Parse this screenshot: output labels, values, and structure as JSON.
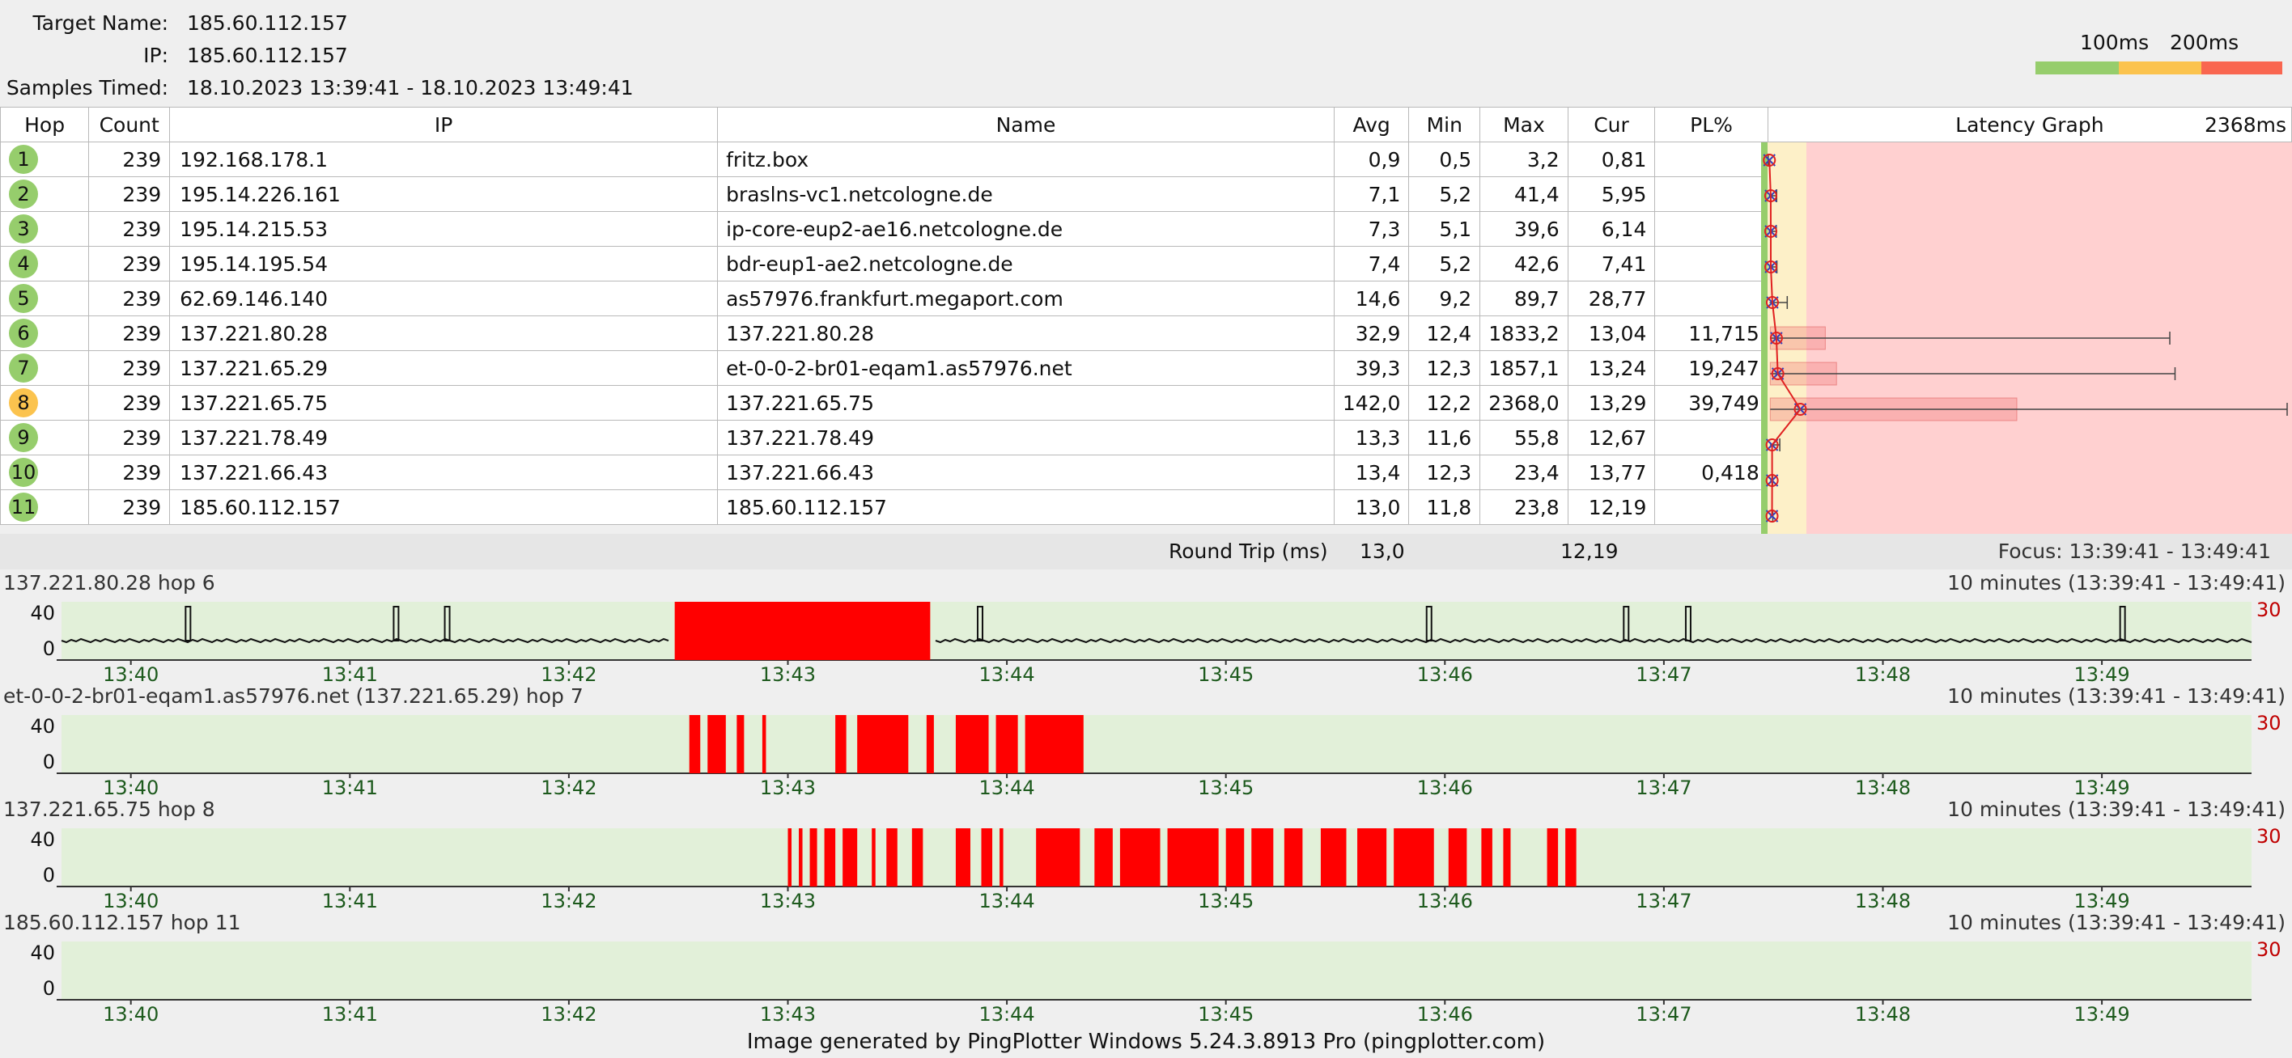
{
  "header": {
    "target_name_label": "Target Name:",
    "target_name": "185.60.112.157",
    "ip_label": "IP:",
    "ip": "185.60.112.157",
    "samples_label": "Samples Timed:",
    "samples": "18.10.2023 13:39:41 - 18.10.2023 13:49:41"
  },
  "legend": {
    "label_100": "100ms",
    "label_200": "200ms",
    "colors": [
      "#96cd6c",
      "#fbc34e",
      "#f96650"
    ]
  },
  "table": {
    "columns": [
      "Hop",
      "Count",
      "IP",
      "Name",
      "Avg",
      "Min",
      "Max",
      "Cur",
      "PL%",
      "Latency Graph"
    ],
    "graph_max": "2368ms",
    "rows": [
      {
        "hop": "1",
        "count": "239",
        "ip": "192.168.178.1",
        "name": "fritz.box",
        "avg": "0,9",
        "min": "0,5",
        "max": "3,2",
        "cur": "0,81",
        "pl": "",
        "status": "green"
      },
      {
        "hop": "2",
        "count": "239",
        "ip": "195.14.226.161",
        "name": "braslns-vc1.netcologne.de",
        "avg": "7,1",
        "min": "5,2",
        "max": "41,4",
        "cur": "5,95",
        "pl": "",
        "status": "green"
      },
      {
        "hop": "3",
        "count": "239",
        "ip": "195.14.215.53",
        "name": "ip-core-eup2-ae16.netcologne.de",
        "avg": "7,3",
        "min": "5,1",
        "max": "39,6",
        "cur": "6,14",
        "pl": "",
        "status": "green"
      },
      {
        "hop": "4",
        "count": "239",
        "ip": "195.14.195.54",
        "name": "bdr-eup1-ae2.netcologne.de",
        "avg": "7,4",
        "min": "5,2",
        "max": "42,6",
        "cur": "7,41",
        "pl": "",
        "status": "green"
      },
      {
        "hop": "5",
        "count": "239",
        "ip": "62.69.146.140",
        "name": "as57976.frankfurt.megaport.com",
        "avg": "14,6",
        "min": "9,2",
        "max": "89,7",
        "cur": "28,77",
        "pl": "",
        "status": "green"
      },
      {
        "hop": "6",
        "count": "239",
        "ip": "137.221.80.28",
        "name": "137.221.80.28",
        "avg": "32,9",
        "min": "12,4",
        "max": "1833,2",
        "cur": "13,04",
        "pl": "11,715",
        "status": "green"
      },
      {
        "hop": "7",
        "count": "239",
        "ip": "137.221.65.29",
        "name": "et-0-0-2-br01-eqam1.as57976.net",
        "avg": "39,3",
        "min": "12,3",
        "max": "1857,1",
        "cur": "13,24",
        "pl": "19,247",
        "status": "green"
      },
      {
        "hop": "8",
        "count": "239",
        "ip": "137.221.65.75",
        "name": "137.221.65.75",
        "avg": "142,0",
        "min": "12,2",
        "max": "2368,0",
        "cur": "13,29",
        "pl": "39,749",
        "status": "orange"
      },
      {
        "hop": "9",
        "count": "239",
        "ip": "137.221.78.49",
        "name": "137.221.78.49",
        "avg": "13,3",
        "min": "11,6",
        "max": "55,8",
        "cur": "12,67",
        "pl": "",
        "status": "green"
      },
      {
        "hop": "10",
        "count": "239",
        "ip": "137.221.66.43",
        "name": "137.221.66.43",
        "avg": "13,4",
        "min": "12,3",
        "max": "23,4",
        "cur": "13,77",
        "pl": "0,418",
        "status": "green"
      },
      {
        "hop": "11",
        "count": "239",
        "ip": "185.60.112.157",
        "name": "185.60.112.157",
        "avg": "13,0",
        "min": "11,8",
        "max": "23,8",
        "cur": "12,19",
        "pl": "",
        "status": "green"
      }
    ]
  },
  "round_trip": {
    "label": "Round Trip (ms)",
    "avg": "13,0",
    "cur": "12,19",
    "focus": "Focus: 13:39:41 - 13:49:41"
  },
  "charts": [
    {
      "title": "137.221.80.28 hop 6",
      "range": "10 minutes (13:39:41 - 13:49:41)",
      "y_top": "40",
      "y_bottom": "0",
      "scale_right": "30"
    },
    {
      "title": "et-0-0-2-br01-eqam1.as57976.net (137.221.65.29) hop 7",
      "range": "10 minutes (13:39:41 - 13:49:41)",
      "y_top": "40",
      "y_bottom": "0",
      "scale_right": "30"
    },
    {
      "title": "137.221.65.75 hop 8",
      "range": "10 minutes (13:39:41 - 13:49:41)",
      "y_top": "40",
      "y_bottom": "0",
      "scale_right": "30"
    },
    {
      "title": "185.60.112.157 hop 11",
      "range": "10 minutes (13:39:41 - 13:49:41)",
      "y_top": "40",
      "y_bottom": "0",
      "scale_right": "30"
    }
  ],
  "time_ticks": [
    "13:40",
    "13:41",
    "13:42",
    "13:43",
    "13:44",
    "13:45",
    "13:46",
    "13:47",
    "13:48",
    "13:49"
  ],
  "chart_data": [
    {
      "type": "timeline",
      "title": "137.221.80.28 hop 6",
      "ylabel": "",
      "ylim": [
        0,
        40
      ],
      "x_range": [
        "13:39:41",
        "13:49:41"
      ],
      "loss_intervals": [
        [
          "13:42:29",
          "13:43:39"
        ]
      ],
      "spikes": [
        "13:40:15",
        "13:41:12",
        "13:41:26",
        "13:43:52",
        "13:45:55",
        "13:46:49",
        "13:47:06",
        "13:49:05"
      ]
    },
    {
      "type": "timeline",
      "title": "et-0-0-2-br01-eqam1.as57976.net (137.221.65.29) hop 7",
      "ylabel": "",
      "ylim": [
        0,
        40
      ],
      "x_range": [
        "13:39:41",
        "13:49:41"
      ],
      "loss_intervals": [
        [
          "13:42:33",
          "13:42:36"
        ],
        [
          "13:42:38",
          "13:42:43"
        ],
        [
          "13:42:46",
          "13:42:48"
        ],
        [
          "13:42:53",
          "13:42:54"
        ],
        [
          "13:43:13",
          "13:43:16"
        ],
        [
          "13:43:19",
          "13:43:33"
        ],
        [
          "13:43:38",
          "13:43:40"
        ],
        [
          "13:43:46",
          "13:43:55"
        ],
        [
          "13:43:57",
          "13:44:03"
        ],
        [
          "13:44:05",
          "13:44:21"
        ]
      ]
    },
    {
      "type": "timeline",
      "title": "137.221.65.75 hop 8",
      "ylabel": "",
      "ylim": [
        0,
        40
      ],
      "x_range": [
        "13:39:41",
        "13:49:41"
      ],
      "loss_intervals": [
        [
          "13:43:00",
          "13:43:01"
        ],
        [
          "13:43:03",
          "13:43:04"
        ],
        [
          "13:43:06",
          "13:43:08"
        ],
        [
          "13:43:10",
          "13:43:13"
        ],
        [
          "13:43:15",
          "13:43:19"
        ],
        [
          "13:43:23",
          "13:43:24"
        ],
        [
          "13:43:27",
          "13:43:30"
        ],
        [
          "13:43:34",
          "13:43:37"
        ],
        [
          "13:43:46",
          "13:43:50"
        ],
        [
          "13:43:53",
          "13:43:56"
        ],
        [
          "13:43:58",
          "13:43:59"
        ],
        [
          "13:44:08",
          "13:44:20"
        ],
        [
          "13:44:24",
          "13:44:29"
        ],
        [
          "13:44:31",
          "13:44:42"
        ],
        [
          "13:44:44",
          "13:44:58"
        ],
        [
          "13:45:00",
          "13:45:05"
        ],
        [
          "13:45:07",
          "13:45:13"
        ],
        [
          "13:45:16",
          "13:45:21"
        ],
        [
          "13:45:26",
          "13:45:33"
        ],
        [
          "13:45:36",
          "13:45:44"
        ],
        [
          "13:45:46",
          "13:45:57"
        ],
        [
          "13:46:01",
          "13:46:06"
        ],
        [
          "13:46:10",
          "13:46:13"
        ],
        [
          "13:46:16",
          "13:46:18"
        ],
        [
          "13:46:28",
          "13:46:31"
        ],
        [
          "13:46:33",
          "13:46:36"
        ]
      ]
    },
    {
      "type": "timeline",
      "title": "185.60.112.157 hop 11",
      "ylabel": "",
      "ylim": [
        0,
        40
      ],
      "x_range": [
        "13:39:41",
        "13:49:41"
      ],
      "loss_intervals": []
    }
  ],
  "footer": "Image generated by PingPlotter Windows 5.24.3.8913 Pro (pingplotter.com)"
}
